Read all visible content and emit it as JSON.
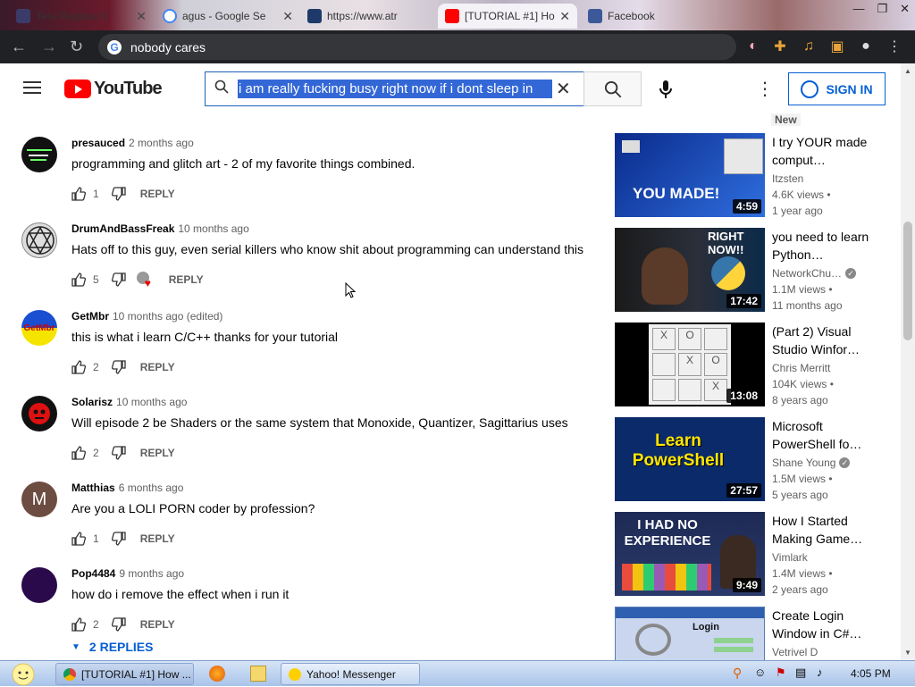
{
  "browser": {
    "tabs": [
      {
        "label": "Tera Replace Il",
        "icon": "wr-icon"
      },
      {
        "label": "agus - Google Se",
        "icon": "google-icon"
      },
      {
        "label": "https://www.atr",
        "icon": "a-icon"
      },
      {
        "label": "[TUTORIAL #1] Ho",
        "icon": "youtube-icon"
      },
      {
        "label": "Facebook",
        "icon": "facebook-icon"
      }
    ],
    "address": "nobody cares"
  },
  "youtube": {
    "logo_text": "YouTube",
    "search_query": "i am really fucking busy right now if i dont sleep in",
    "signin_label": "SIGN IN"
  },
  "comments": [
    {
      "author": "presauced",
      "time": "2 months ago",
      "text": "programming and glitch art - 2 of my favorite things combined.",
      "likes": "1",
      "reply": "REPLY",
      "avatar_color": "#111111"
    },
    {
      "author": "DrumAndBassFreak",
      "time": "10 months ago",
      "text": "Hats off to this guy, even serial killers who know shit about programming can understand this",
      "likes": "5",
      "reply": "REPLY",
      "avatar_color": "#dddddd"
    },
    {
      "author": "GetMbr",
      "time": "10 months ago (edited)",
      "text": "this is what i learn C/C++ thanks for your tutorial",
      "likes": "2",
      "reply": "REPLY",
      "avatar_color": "#1a4fd1"
    },
    {
      "author": "Solarisz",
      "time": "10 months ago",
      "text": "Will episode 2 be Shaders or the same system that Monoxide, Quantizer, Sagittarius uses",
      "likes": "2",
      "reply": "REPLY",
      "avatar_color": "#111111"
    },
    {
      "author": "Matthias",
      "time": "6 months ago",
      "text": "Are you a LOLI PORN coder by profession?",
      "likes": "1",
      "reply": "REPLY",
      "avatar_color": "#6d4c41",
      "initial": "M"
    },
    {
      "author": "Pop4484",
      "time": "9 months ago",
      "text": "how do i remove the effect when i run it",
      "likes": "2",
      "reply": "REPLY",
      "avatar_color": "#2a0a4a"
    }
  ],
  "replies_toggle": "2 REPLIES",
  "sidebar": {
    "new_badge": "New",
    "videos": [
      {
        "title": "I try YOUR made comput…",
        "channel": "Itzsten",
        "verified": false,
        "views": "4.6K views •",
        "age": "1 year ago",
        "duration": "4:59",
        "thumb_text": "YOU MADE!"
      },
      {
        "title": "you need to learn Python…",
        "channel": "NetworkChu…",
        "verified": true,
        "views": "1.1M views •",
        "age": "11 months ago",
        "duration": "17:42",
        "thumb_text": "RIGHT NOW!!"
      },
      {
        "title": "(Part 2) Visual Studio Winfor…",
        "channel": "Chris Merritt",
        "verified": false,
        "views": "104K views •",
        "age": "8 years ago",
        "duration": "13:08",
        "thumb_text": ""
      },
      {
        "title": "Microsoft PowerShell fo…",
        "channel": "Shane Young",
        "verified": true,
        "views": "1.5M views •",
        "age": "5 years ago",
        "duration": "27:57",
        "thumb_text": "Learn PowerShell"
      },
      {
        "title": "How I Started Making Game…",
        "channel": "Vimlark",
        "verified": false,
        "views": "1.4M views •",
        "age": "2 years ago",
        "duration": "9:49",
        "thumb_text": "I HAD NO EXPERIENCE"
      },
      {
        "title": "Create Login Window in C#…",
        "channel": "Vetrivel D",
        "verified": false,
        "views": "",
        "age": "",
        "duration": "",
        "thumb_text": "Login"
      }
    ]
  },
  "taskbar": {
    "buttons": [
      {
        "label": "[TUTORIAL #1] How ..."
      },
      {
        "label": "Yahoo! Messenger"
      }
    ],
    "clock": "4:05 PM"
  }
}
